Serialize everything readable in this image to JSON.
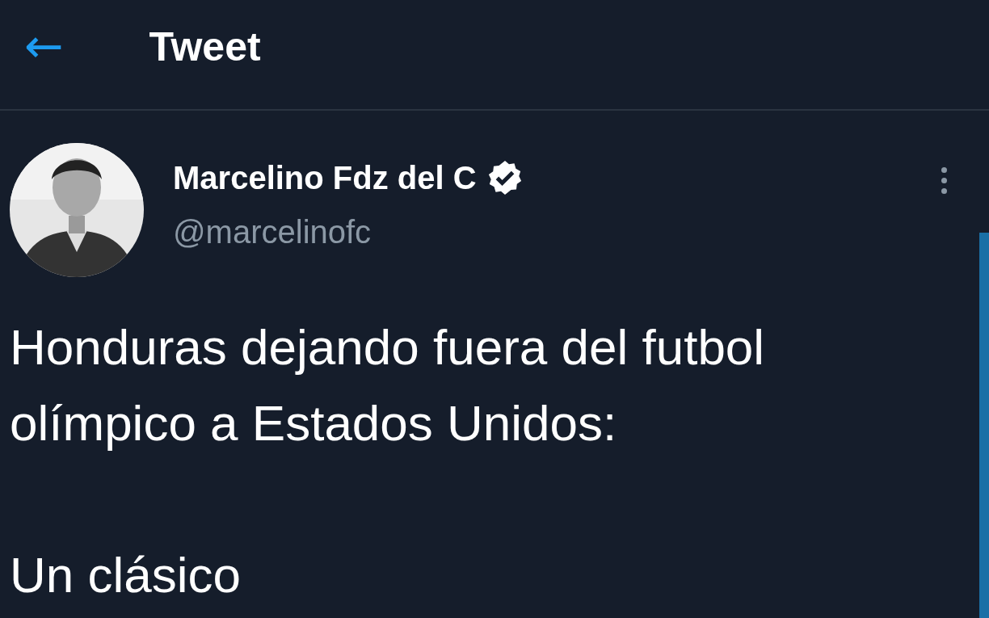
{
  "header": {
    "back_icon": "←",
    "title": "Tweet"
  },
  "tweet": {
    "author": {
      "name": "Marcelino Fdz del C",
      "verified": true,
      "handle": "@marcelinofc"
    },
    "paragraphs": [
      "Honduras dejando fuera del futbol olímpico a Estados Unidos:",
      "Un clásico"
    ]
  }
}
